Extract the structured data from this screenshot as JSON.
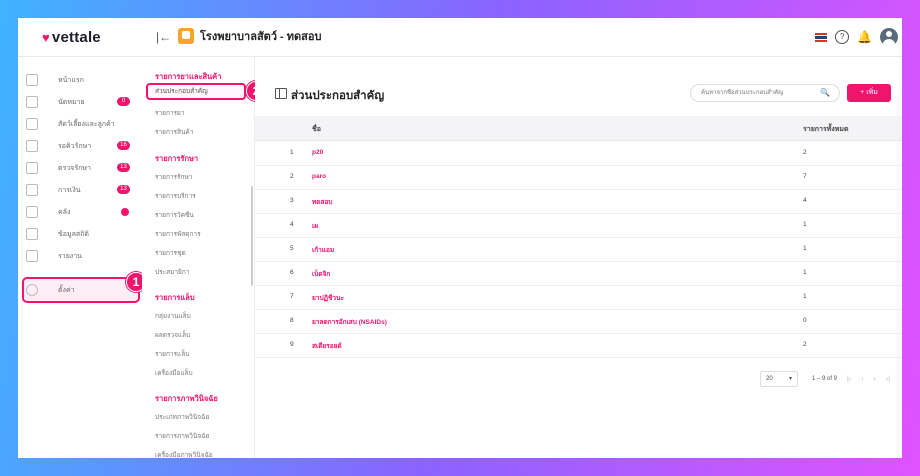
{
  "app": {
    "brand": "vettale",
    "clinic_name": "โรงพยาบาลสัตว์ - ทดสอบ"
  },
  "sidenav": [
    {
      "label": "หน้าแรก"
    },
    {
      "label": "นัดหมาย",
      "badge": "0"
    },
    {
      "label": "สัตว์เลี้ยงและลูกค้า"
    },
    {
      "label": "รอคิวรักษา",
      "badge": "16"
    },
    {
      "label": "ตรวจรักษา",
      "badge": "13"
    },
    {
      "label": "การเงิน",
      "badge": "13"
    },
    {
      "label": "คลัง",
      "dot": true
    },
    {
      "label": "ข้อมูลสถิติ"
    },
    {
      "label": "รายงาน"
    },
    {
      "label": "ตั้งค่า"
    }
  ],
  "callouts": {
    "one": "1",
    "two": "2"
  },
  "subnav": {
    "sections": [
      {
        "heading": "รายการยาและสินค้า",
        "items": [
          "ส่วนประกอบสำคัญ",
          "รายการยา",
          "รายการสินค้า"
        ]
      },
      {
        "heading": "รายการรักษา",
        "items": [
          "รายการรักษา",
          "รายการบริการ",
          "รายการวัคซีน",
          "รายการพัสดุการ",
          "รายการชุด",
          "ประสมายิกา"
        ]
      },
      {
        "heading": "รายการแล็บ",
        "items": [
          "กลุ่มงานแล็บ",
          "ผลตรวจแล็บ",
          "รายการแล็บ",
          "เครื่องมือแล็บ"
        ]
      },
      {
        "heading": "รายการภาพวินิจฉัย",
        "items": [
          "ประเภทภาพวินิจฉัย",
          "รายการภาพวินิจฉัย",
          "เครื่องมือภาพวินิจฉัย"
        ]
      }
    ]
  },
  "main": {
    "title": "ส่วนประกอบสำคัญ",
    "search_placeholder": "ค้นหาจากชื่อส่วนประกอบสำคัญ",
    "add_label": "+ เพิ่ม",
    "columns": {
      "name": "ชื่อ",
      "count": "รายการทั้งหมด"
    },
    "rows": [
      {
        "num": "1",
        "name": "p20",
        "count": "2"
      },
      {
        "num": "2",
        "name": "paro",
        "count": "7"
      },
      {
        "num": "3",
        "name": "ทดสอบ",
        "count": "4"
      },
      {
        "num": "4",
        "name": "เผ",
        "count": "1"
      },
      {
        "num": "5",
        "name": "เก้าแอม",
        "count": "1"
      },
      {
        "num": "6",
        "name": "เบ็ดจิก",
        "count": "1"
      },
      {
        "num": "7",
        "name": "ยาปฏิชีวนะ",
        "count": "1"
      },
      {
        "num": "8",
        "name": "ยาลดการอักเสบ (NSAIDs)",
        "count": "0"
      },
      {
        "num": "9",
        "name": "สเตียรอยด์",
        "count": "2"
      }
    ],
    "pager": {
      "per_page": "20",
      "range": "1 – 9 of 9"
    }
  }
}
